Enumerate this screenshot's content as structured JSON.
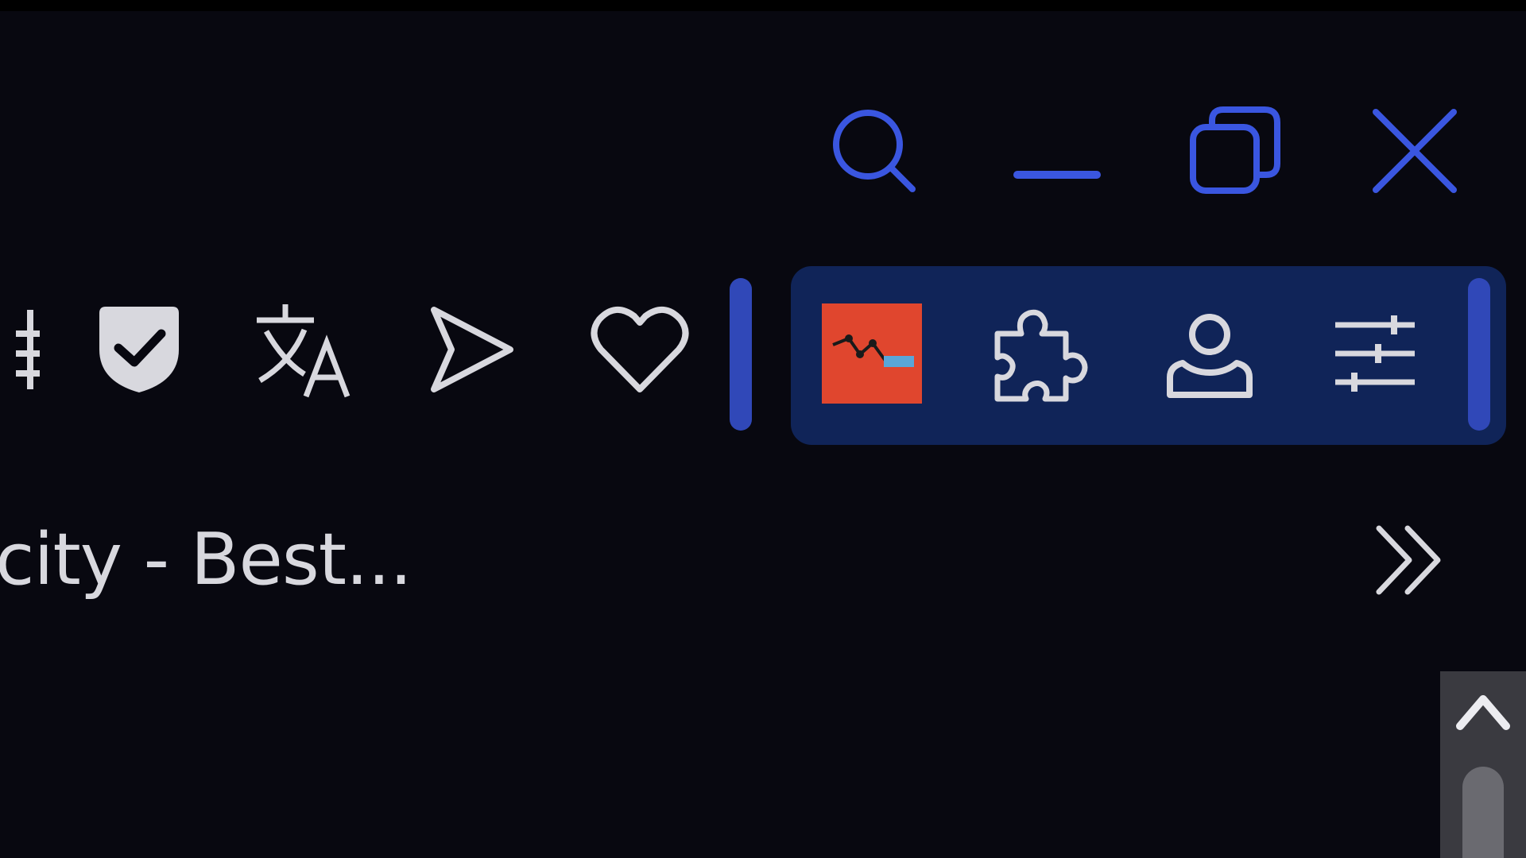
{
  "window_controls": {
    "search_icon": "search-icon",
    "minimize_icon": "minimize-icon",
    "restore_icon": "restore-icon",
    "close_icon": "close-icon",
    "accent_color": "#3a56e0"
  },
  "toolbar": {
    "icons": [
      "partial-icon",
      "shield-check-icon",
      "translate-icon",
      "send-icon",
      "heart-icon"
    ],
    "extensions": [
      "red-extension-icon",
      "puzzle-icon",
      "profile-icon",
      "sliders-icon"
    ]
  },
  "bookmarks": {
    "visible_text": "city - Best...",
    "more_icon": "chevron-double-right-icon"
  },
  "scrollbar": {
    "up_icon": "chevron-up-icon"
  }
}
